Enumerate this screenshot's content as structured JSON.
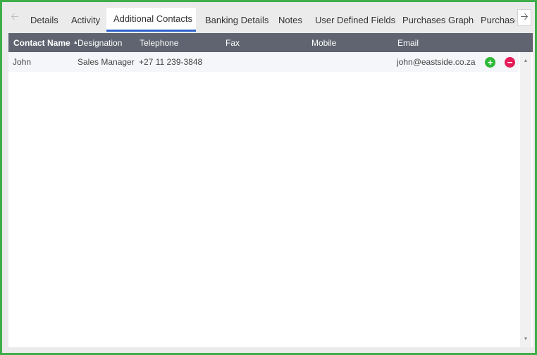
{
  "tabs": [
    {
      "label": "Details"
    },
    {
      "label": "Activity"
    },
    {
      "label": "Additional Contacts"
    },
    {
      "label": "Banking Details"
    },
    {
      "label": "Notes"
    },
    {
      "label": "User Defined Fields"
    },
    {
      "label": "Purchases Graph"
    },
    {
      "label": "Purchase G"
    }
  ],
  "nav": {
    "prev_icon": "arrow-left-icon",
    "next_icon": "arrow-right-icon"
  },
  "table": {
    "columns": [
      {
        "label": "Contact Name",
        "sorted": "ascending"
      },
      {
        "label": "Designation"
      },
      {
        "label": "Telephone"
      },
      {
        "label": "Fax"
      },
      {
        "label": "Mobile"
      },
      {
        "label": "Email"
      }
    ],
    "rows": [
      {
        "contact_name": "John",
        "designation": "Sales Manager",
        "telephone": "+27 11 239-3848",
        "fax": "",
        "mobile": "",
        "email": "john@eastside.co.za"
      }
    ],
    "row_actions": {
      "add_icon": "plus-circle-icon",
      "remove_icon": "minus-circle-icon"
    }
  },
  "colors": {
    "frame_border": "#3fae49",
    "header_bg": "#5f6470",
    "active_tab_underline": "#2d62c9",
    "add": "#2fb838",
    "remove": "#e51d5b"
  }
}
